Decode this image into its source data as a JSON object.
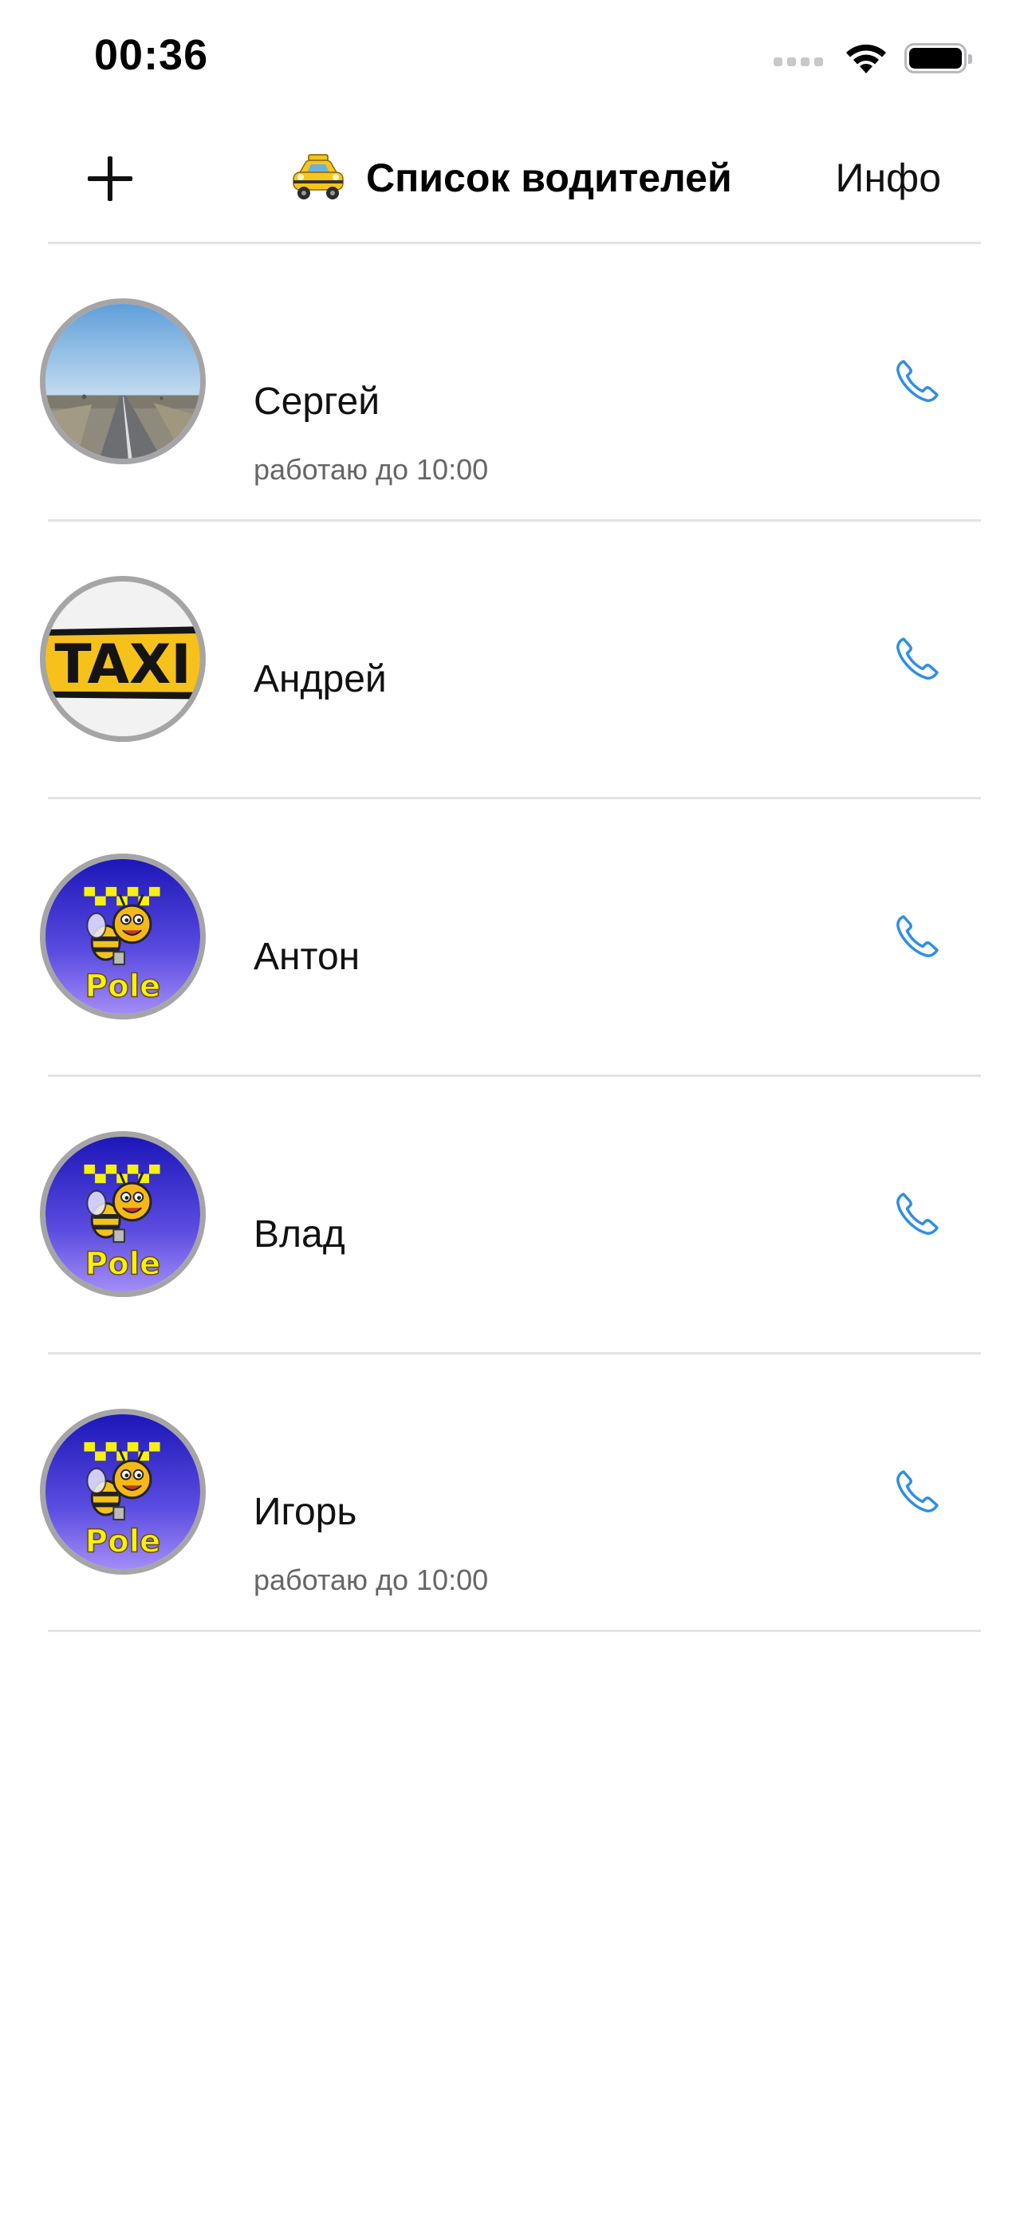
{
  "status_bar": {
    "time": "00:36",
    "signal_icon": "cellular-signal-icon",
    "wifi_icon": "wifi-icon",
    "battery_icon": "battery-icon",
    "battery_level": 1.0
  },
  "nav": {
    "add_icon": "plus-icon",
    "title_icon": "taxi-emoji-icon",
    "title": "Список водителей",
    "info_label": "Инфо"
  },
  "accent_color": "#2f8ee5",
  "drivers": [
    {
      "name": "Сергей",
      "note": "работаю до 10:00",
      "avatar": "road-photo",
      "call_icon": "phone-icon"
    },
    {
      "name": "Андрей",
      "note": "",
      "avatar": "taxi-sign-photo",
      "call_icon": "phone-icon"
    },
    {
      "name": "Антон",
      "note": "",
      "avatar": "bee-pole-logo",
      "call_icon": "phone-icon"
    },
    {
      "name": "Влад",
      "note": "",
      "avatar": "bee-pole-logo",
      "call_icon": "phone-icon"
    },
    {
      "name": "Игорь",
      "note": "работаю до 10:00",
      "avatar": "bee-pole-logo",
      "call_icon": "phone-icon"
    }
  ]
}
